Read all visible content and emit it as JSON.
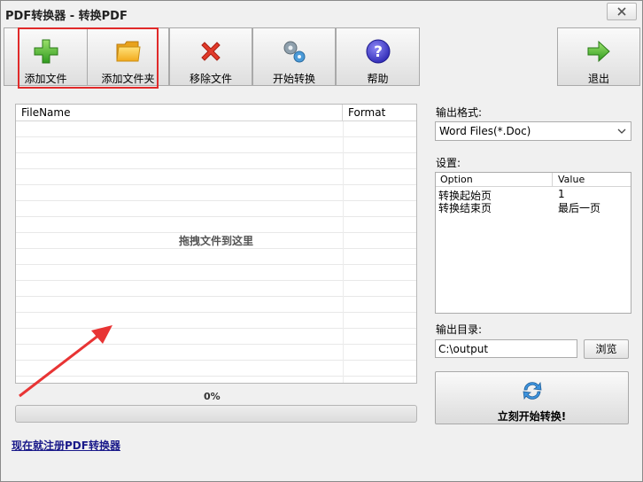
{
  "window": {
    "title": "PDF转换器 - 转换PDF"
  },
  "toolbar": {
    "add_file": "添加文件",
    "add_folder": "添加文件夹",
    "remove_file": "移除文件",
    "start_convert": "开始转换",
    "help": "帮助",
    "exit": "退出"
  },
  "file_list": {
    "columns": [
      "FileName",
      "Format"
    ],
    "drop_hint": "拖拽文件到这里",
    "rows": []
  },
  "progress": {
    "label": "0%",
    "fraction": 0
  },
  "register_link": "现在就注册PDF转换器",
  "output_format": {
    "label": "输出格式:",
    "selected": "Word Files(*.Doc)"
  },
  "settings": {
    "label": "设置:",
    "columns": [
      "Option",
      "Value"
    ],
    "rows": [
      {
        "option": "转换起始页",
        "value": "1"
      },
      {
        "option": "转换结束页",
        "value": "最后一页"
      }
    ]
  },
  "output_dir": {
    "label": "输出目录:",
    "value": "C:\\output",
    "browse": "浏览"
  },
  "start_button": {
    "label": "立刻开始转换!"
  },
  "colors": {
    "highlight": "#e02a2a",
    "annotation_arrow": "#e83434",
    "link": "#1a1a8a"
  }
}
